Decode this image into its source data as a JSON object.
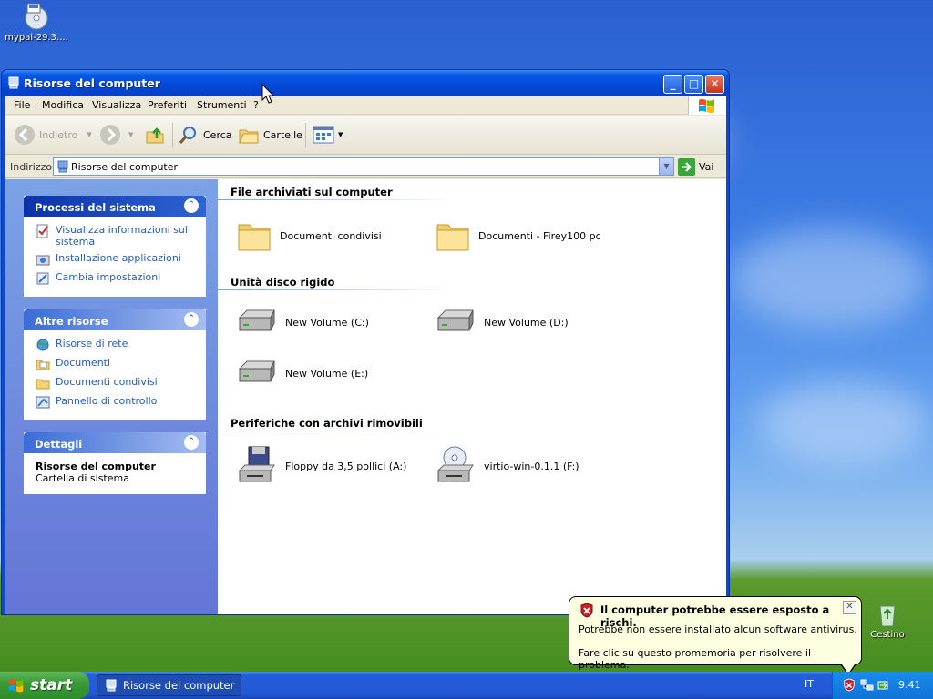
{
  "desktop": {
    "icon1_label": "mypal-29.3....",
    "recycle_label": "Cestino"
  },
  "window": {
    "title": "Risorse del computer",
    "menu": [
      "File",
      "Modifica",
      "Visualizza",
      "Preferiti",
      "Strumenti",
      "?"
    ],
    "toolbar": {
      "back_label": "Indietro",
      "search_label": "Cerca",
      "folders_label": "Cartelle"
    },
    "address": {
      "label": "Indirizzo",
      "value": "Risorse del computer",
      "go_label": "Vai"
    },
    "tasks": {
      "system": {
        "title": "Processi del sistema",
        "items": [
          "Visualizza informazioni sul sistema",
          "Installazione applicazioni",
          "Cambia impostazioni"
        ]
      },
      "other": {
        "title": "Altre risorse",
        "items": [
          "Risorse di rete",
          "Documenti",
          "Documenti condivisi",
          "Pannello di controllo"
        ]
      },
      "details": {
        "title": "Dettagli",
        "name": "Risorse del computer",
        "type": "Cartella di sistema"
      }
    },
    "groups": {
      "stored": {
        "title": "File archiviati sul computer",
        "items": [
          "Documenti condivisi",
          "Documenti - Firey100 pc"
        ]
      },
      "disks": {
        "title": "Unità disco rigido",
        "items": [
          "New Volume (C:)",
          "New Volume (D:)",
          "New Volume (E:)"
        ]
      },
      "removable": {
        "title": "Periferiche con archivi rimovibili",
        "items": [
          "Floppy da 3,5 pollici (A:)",
          "virtio-win-0.1.1 (F:)"
        ]
      }
    }
  },
  "taskbar": {
    "start_label": "start",
    "task_button": "Risorse del computer",
    "language": "IT",
    "clock": "9.41"
  },
  "balloon": {
    "title": "Il computer potrebbe essere esposto a rischi.",
    "line1": "Potrebbe non essere installato alcun software antivirus.",
    "line2": "Fare clic su questo promemoria per risolvere il problema."
  },
  "colors": {
    "title_blue": "#0548d8",
    "task_link": "#215dc6",
    "start_green": "#3a9b36",
    "balloon_bg": "#ffffe1"
  }
}
